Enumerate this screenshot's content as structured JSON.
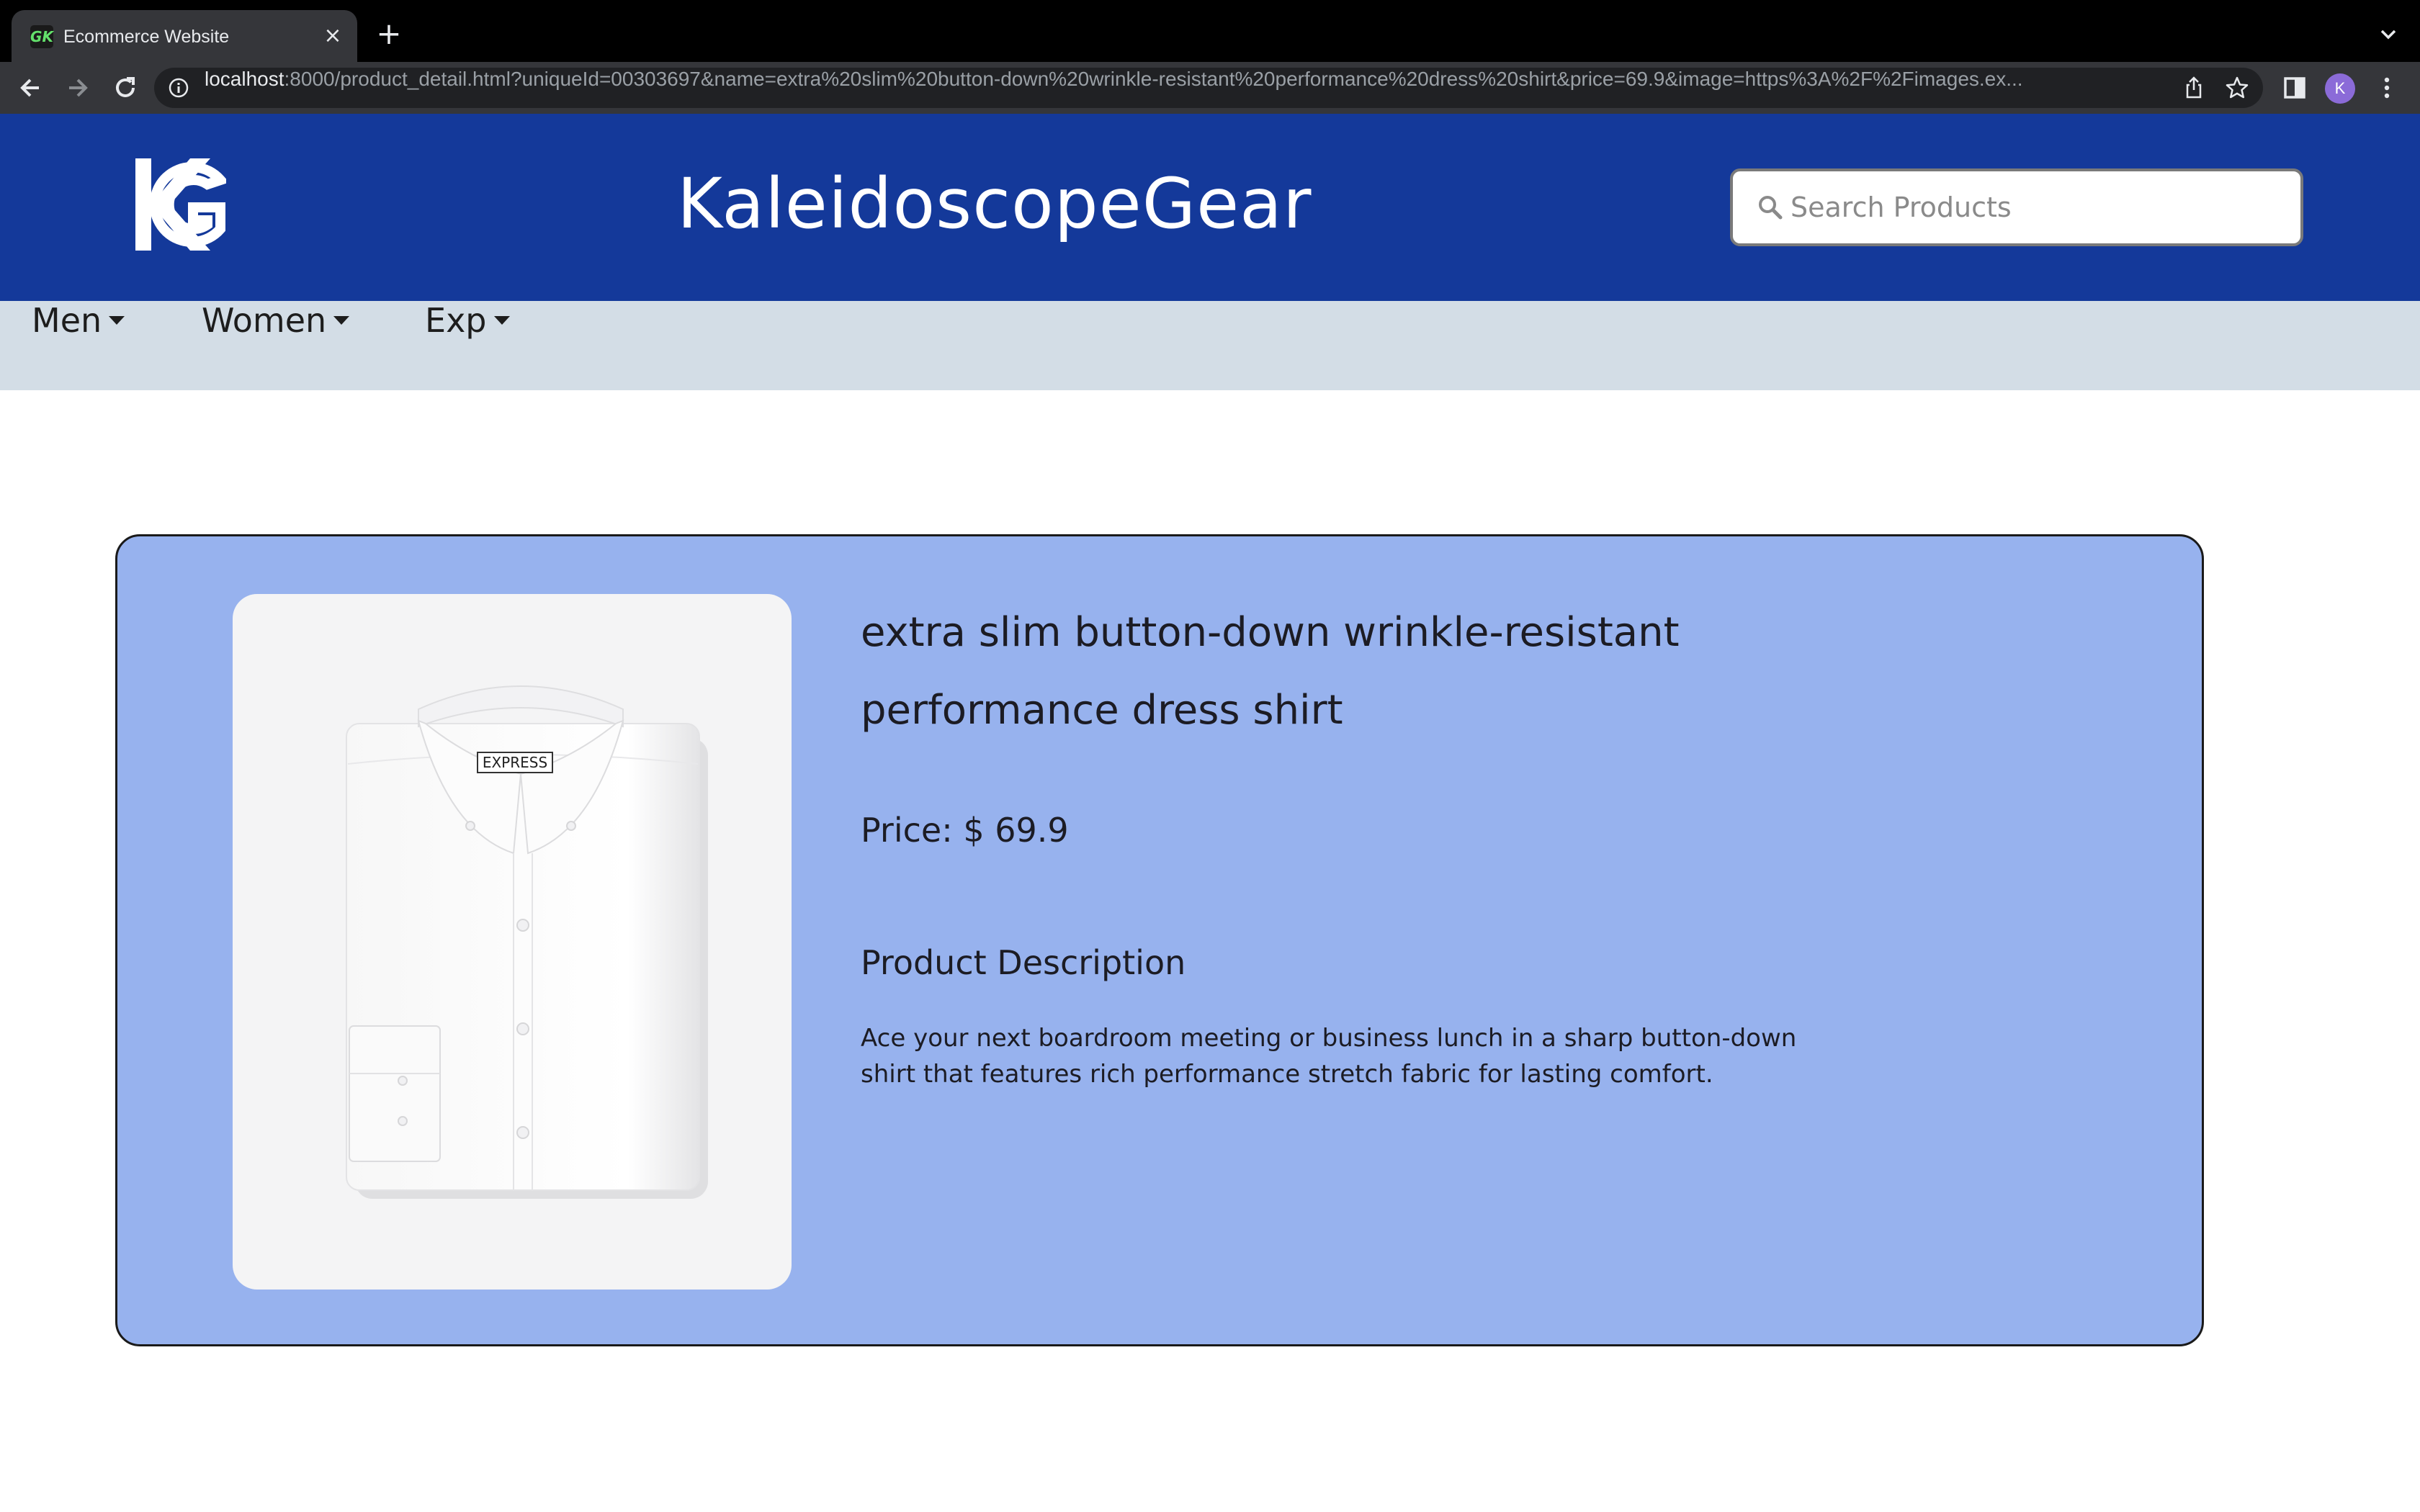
{
  "browser": {
    "tab_title": "Ecommerce Website",
    "tab_favicon_text": "GK",
    "url_host": "localhost",
    "url_rest": ":8000/product_detail.html?uniqueId=00303697&name=extra%20slim%20button-down%20wrinkle-resistant%20performance%20dress%20shirt&price=69.9&image=https%3A%2F%2Fimages.ex...",
    "profile_initial": "K"
  },
  "header": {
    "brand": "KaleidoscopeGear",
    "search_placeholder": "Search Products"
  },
  "nav": {
    "items": [
      {
        "label": "Men"
      },
      {
        "label": "Women"
      },
      {
        "label": "Exp"
      }
    ]
  },
  "product": {
    "title": "extra slim button-down wrinkle-resistant performance dress shirt",
    "price": "Price: $ 69.9",
    "description_heading": "Product Description",
    "description": "Ace your next boardroom meeting or business lunch in a sharp button-down shirt that features rich performance stretch fabric for lasting comfort.",
    "image_label": "EXPRESS"
  },
  "colors": {
    "header_bg": "#14399a",
    "nav_bg": "#d3dde6",
    "card_bg": "#97b2ee"
  }
}
